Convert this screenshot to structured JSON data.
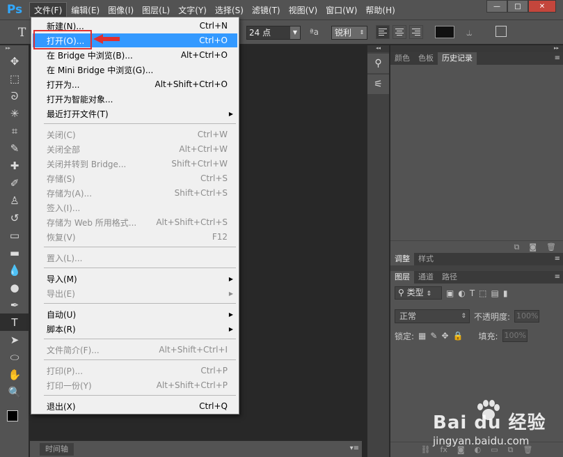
{
  "app": {
    "logo": "Ps"
  },
  "menubar": {
    "items": [
      "文件(F)",
      "编辑(E)",
      "图像(I)",
      "图层(L)",
      "文字(Y)",
      "选择(S)",
      "滤镜(T)",
      "视图(V)",
      "窗口(W)",
      "帮助(H)"
    ],
    "active_index": 0,
    "window_buttons": {
      "minimize": "—",
      "maximize": "□",
      "close": "✕"
    }
  },
  "options": {
    "tool_glyph": "T",
    "font_size": "24 点",
    "aa_icon": "ªa",
    "antialias": "锐利",
    "text_color": "#111111"
  },
  "toolbar": {
    "tools": [
      {
        "name": "move-tool",
        "glyph": "✥"
      },
      {
        "name": "marquee-tool",
        "glyph": "⬚"
      },
      {
        "name": "lasso-tool",
        "glyph": "ᘐ"
      },
      {
        "name": "magic-wand-tool",
        "glyph": "✳"
      },
      {
        "name": "crop-tool",
        "glyph": "⌗"
      },
      {
        "name": "eyedropper-tool",
        "glyph": "✎"
      },
      {
        "name": "healing-tool",
        "glyph": "✚"
      },
      {
        "name": "brush-tool",
        "glyph": "✐"
      },
      {
        "name": "stamp-tool",
        "glyph": "♙"
      },
      {
        "name": "history-brush-tool",
        "glyph": "↺"
      },
      {
        "name": "eraser-tool",
        "glyph": "▭"
      },
      {
        "name": "gradient-tool",
        "glyph": "▬"
      },
      {
        "name": "blur-tool",
        "glyph": "💧"
      },
      {
        "name": "dodge-tool",
        "glyph": "●"
      },
      {
        "name": "pen-tool",
        "glyph": "✒"
      },
      {
        "name": "type-tool",
        "glyph": "T"
      },
      {
        "name": "path-select-tool",
        "glyph": "➤"
      },
      {
        "name": "ellipse-tool",
        "glyph": "⬭"
      },
      {
        "name": "hand-tool",
        "glyph": "✋"
      },
      {
        "name": "zoom-tool",
        "glyph": "🔍"
      }
    ],
    "selected_index": 15
  },
  "file_menu": {
    "items": [
      {
        "label": "新建(N)...",
        "shortcut": "Ctrl+N",
        "enabled": true
      },
      {
        "label": "打开(O)...",
        "shortcut": "Ctrl+O",
        "enabled": true,
        "highlighted": true
      },
      {
        "label": "在 Bridge 中浏览(B)...",
        "shortcut": "Alt+Ctrl+O",
        "enabled": true
      },
      {
        "label": "在 Mini Bridge 中浏览(G)...",
        "shortcut": "",
        "enabled": true
      },
      {
        "label": "打开为...",
        "shortcut": "Alt+Shift+Ctrl+O",
        "enabled": true
      },
      {
        "label": "打开为智能对象...",
        "shortcut": "",
        "enabled": true
      },
      {
        "label": "最近打开文件(T)",
        "shortcut": "",
        "enabled": true,
        "submenu": true
      },
      {
        "label": "关闭(C)",
        "shortcut": "Ctrl+W",
        "enabled": false
      },
      {
        "label": "关闭全部",
        "shortcut": "Alt+Ctrl+W",
        "enabled": false
      },
      {
        "label": "关闭并转到 Bridge...",
        "shortcut": "Shift+Ctrl+W",
        "enabled": false
      },
      {
        "label": "存储(S)",
        "shortcut": "Ctrl+S",
        "enabled": false
      },
      {
        "label": "存储为(A)...",
        "shortcut": "Shift+Ctrl+S",
        "enabled": false
      },
      {
        "label": "签入(I)...",
        "shortcut": "",
        "enabled": false
      },
      {
        "label": "存储为 Web 所用格式...",
        "shortcut": "Alt+Shift+Ctrl+S",
        "enabled": false
      },
      {
        "label": "恢复(V)",
        "shortcut": "F12",
        "enabled": false
      },
      {
        "label": "置入(L)...",
        "shortcut": "",
        "enabled": false
      },
      {
        "label": "导入(M)",
        "shortcut": "",
        "enabled": true,
        "submenu": true
      },
      {
        "label": "导出(E)",
        "shortcut": "",
        "enabled": false,
        "submenu": true
      },
      {
        "label": "自动(U)",
        "shortcut": "",
        "enabled": true,
        "submenu": true
      },
      {
        "label": "脚本(R)",
        "shortcut": "",
        "enabled": true,
        "submenu": true
      },
      {
        "label": "文件简介(F)...",
        "shortcut": "Alt+Shift+Ctrl+I",
        "enabled": false
      },
      {
        "label": "打印(P)...",
        "shortcut": "Ctrl+P",
        "enabled": false
      },
      {
        "label": "打印一份(Y)",
        "shortcut": "Alt+Shift+Ctrl+P",
        "enabled": false
      },
      {
        "label": "退出(X)",
        "shortcut": "Ctrl+Q",
        "enabled": true
      }
    ]
  },
  "right_panels": {
    "top_tabs": [
      "颜色",
      "色板",
      "历史记录"
    ],
    "top_active": 2,
    "mid_tabs": [
      "调整",
      "样式"
    ],
    "mid_active": 0,
    "layer_tabs": [
      "图层",
      "通道",
      "路径"
    ],
    "layer_active": 0,
    "kind_filter": "类型",
    "blend_mode": "正常",
    "opacity_label": "不透明度:",
    "opacity_value": "100%",
    "lock_label": "锁定:",
    "fill_label": "填充:",
    "fill_value": "100%"
  },
  "timeline": {
    "tab": "时间轴"
  },
  "watermark": {
    "brand": "Bai du 经验",
    "url": "jingyan.baidu.com"
  },
  "colors": {
    "highlight": "#3399ff",
    "annotation_red": "#e03030",
    "ps_blue": "#31a8ff"
  }
}
